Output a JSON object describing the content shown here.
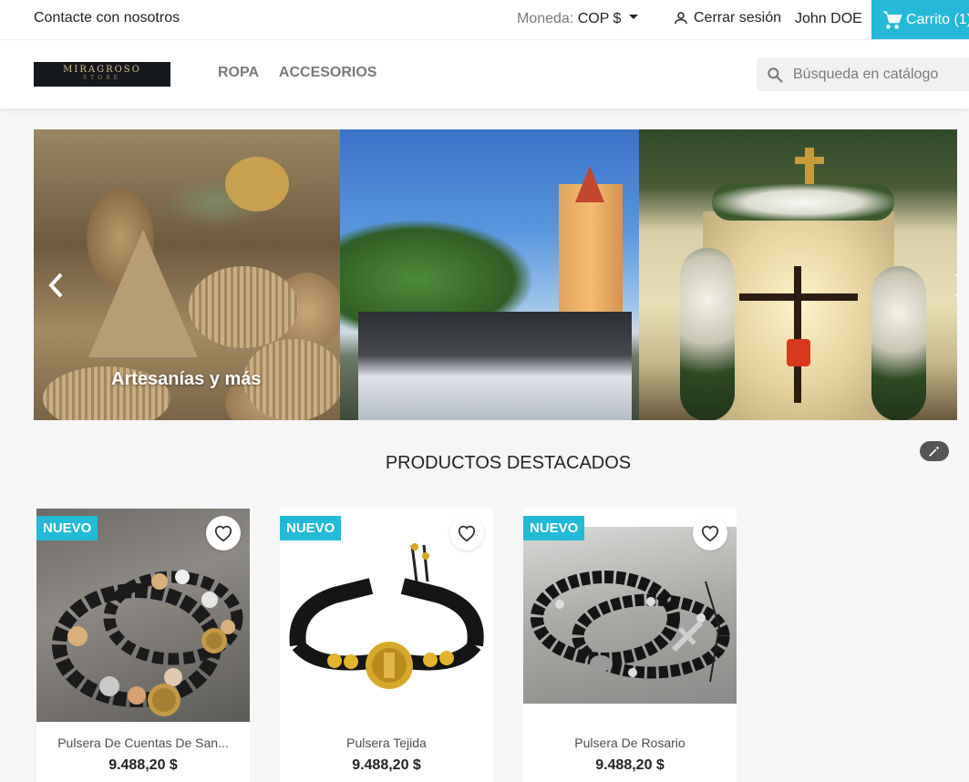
{
  "topnav": {
    "contact": "Contacte con nosotros",
    "currency_label": "Moneda:",
    "currency_value": "COP $",
    "signout": "Cerrar sesión",
    "user": "John DOE",
    "cart": "Carrito (1)"
  },
  "header": {
    "logo_line1": "MIRAGROSO",
    "logo_line2": "STORE",
    "menu": [
      "ROPA",
      "ACCESORIOS"
    ],
    "search_placeholder": "Búsqueda en catálogo"
  },
  "carousel": {
    "caption": "Artesanías y más"
  },
  "featured": {
    "title": "PRODUCTOS DESTACADOS",
    "products": [
      {
        "badge": "NUEVO",
        "name": "Pulsera De Cuentas De San...",
        "price": "9.488,20 $"
      },
      {
        "badge": "NUEVO",
        "name": "Pulsera Tejida",
        "price": "9.488,20 $"
      },
      {
        "badge": "NUEVO",
        "name": "Pulsera De Rosario",
        "price": "9.488,20 $"
      }
    ]
  },
  "colors": {
    "accent": "#24b9d7"
  }
}
